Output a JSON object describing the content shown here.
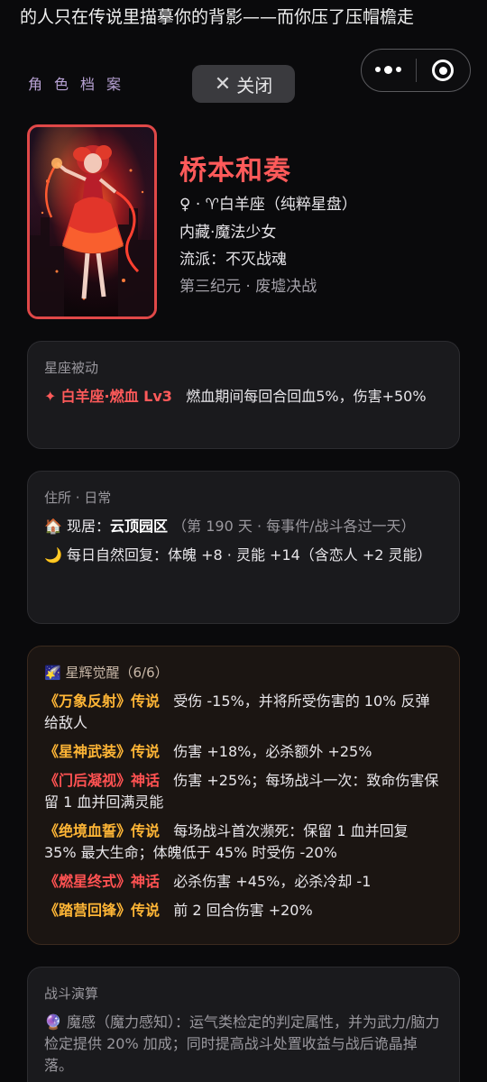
{
  "ticker": "的人只在传说里描摹你的背影——而你压了压帽檐走",
  "section_tag": "角色档案",
  "close_label": "关闭",
  "character": {
    "name": "桥本和奏",
    "gender_sign": "♀ · ♈白羊座（纯粹星盘）",
    "hidden": "内藏·魔法少女",
    "style": "流派：不灭战魂",
    "era": "第三纪元 · 废墟决战"
  },
  "passive": {
    "title": "星座被动",
    "icon": "✦",
    "name": "白羊座·燃血 Lv3",
    "desc": "燃血期间每回合回血5%，伤害+50%"
  },
  "residence": {
    "title": "住所 · 日常",
    "home_icon": "🏠",
    "home_label": "现居：",
    "home_name": "云顶园区",
    "home_note": "（第 190 天 · 每事件/战斗各过一天）",
    "moon_icon": "🌙",
    "recovery": "每日自然回复：体魄 +8 · 灵能 +14（含恋人 +2 灵能）"
  },
  "awakening": {
    "icon": "🌠",
    "title": "星辉觉醒（6/6）",
    "items": [
      {
        "name": "《万象反射》传说",
        "tier": "legend",
        "desc": "受伤 -15%，并将所受伤害的 10% 反弹给敌人"
      },
      {
        "name": "《星神武装》传说",
        "tier": "legend",
        "desc": "伤害 +18%，必杀额外 +25%"
      },
      {
        "name": "《门后凝视》神话",
        "tier": "myth",
        "desc": "伤害 +25%；每场战斗一次：致命伤害保留 1 血并回满灵能"
      },
      {
        "name": "《绝境血誓》传说",
        "tier": "legend",
        "desc": "每场战斗首次濒死：保留 1 血并回复 35% 最大生命；体魄低于 45% 时受伤 -20%"
      },
      {
        "name": "《燃星终式》神话",
        "tier": "myth",
        "desc": "必杀伤害 +45%，必杀冷却 -1"
      },
      {
        "name": "《踏营回锋》传说",
        "tier": "legend",
        "desc": "前 2 回合伤害 +20%"
      }
    ]
  },
  "battle": {
    "title": "战斗演算",
    "icon": "🔮",
    "desc": "魔感（魔力感知）：运气类检定的判定属性，并为武力/脑力检定提供 20% 加成；同时提高战斗处置收益与战后诡晶掉落。"
  }
}
